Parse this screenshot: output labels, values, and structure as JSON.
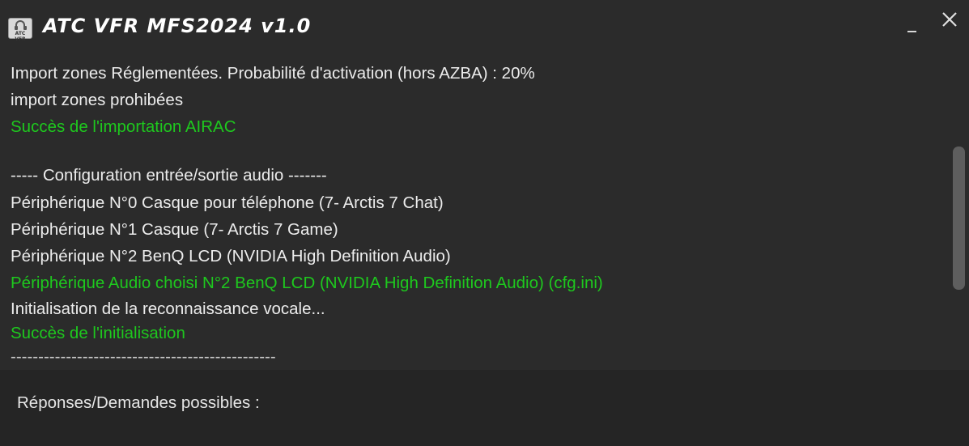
{
  "window": {
    "title": "ATC VFR MFS2024 v1.0",
    "icon_name": "headset-app-icon",
    "icon_text": "ATC VFR"
  },
  "log": {
    "lines": [
      {
        "text": "Import zones Réglementées. Probabilité d'activation (hors AZBA) : 20%",
        "status": "normal"
      },
      {
        "text": "import zones prohibées",
        "status": "normal"
      },
      {
        "text": "Succès de l'importation AIRAC",
        "status": "success"
      },
      {
        "text": "",
        "status": "normal"
      },
      {
        "text": "----- Configuration entrée/sortie audio -------",
        "status": "normal"
      },
      {
        "text": "Périphérique N°0 Casque pour téléphone (7- Arctis 7 Chat)",
        "status": "normal"
      },
      {
        "text": "Périphérique N°1 Casque (7- Arctis 7 Game)",
        "status": "normal"
      },
      {
        "text": "Périphérique N°2 BenQ LCD (NVIDIA High Definition Audio)",
        "status": "normal"
      },
      {
        "text": "Périphérique Audio choisi N°2 BenQ LCD (NVIDIA High Definition Audio) (cfg.ini)",
        "status": "success"
      },
      {
        "text": "Initialisation de la reconnaissance vocale...",
        "status": "normal"
      },
      {
        "text": "Succès de l'initialisation",
        "status": "success"
      },
      {
        "text": "------------------------------------------------",
        "status": "separator"
      }
    ]
  },
  "bottom": {
    "label": "Réponses/Demandes possibles :"
  },
  "colors": {
    "background": "#2b2b2b",
    "text": "#ececec",
    "success": "#1ec81e",
    "panel": "#252525"
  }
}
